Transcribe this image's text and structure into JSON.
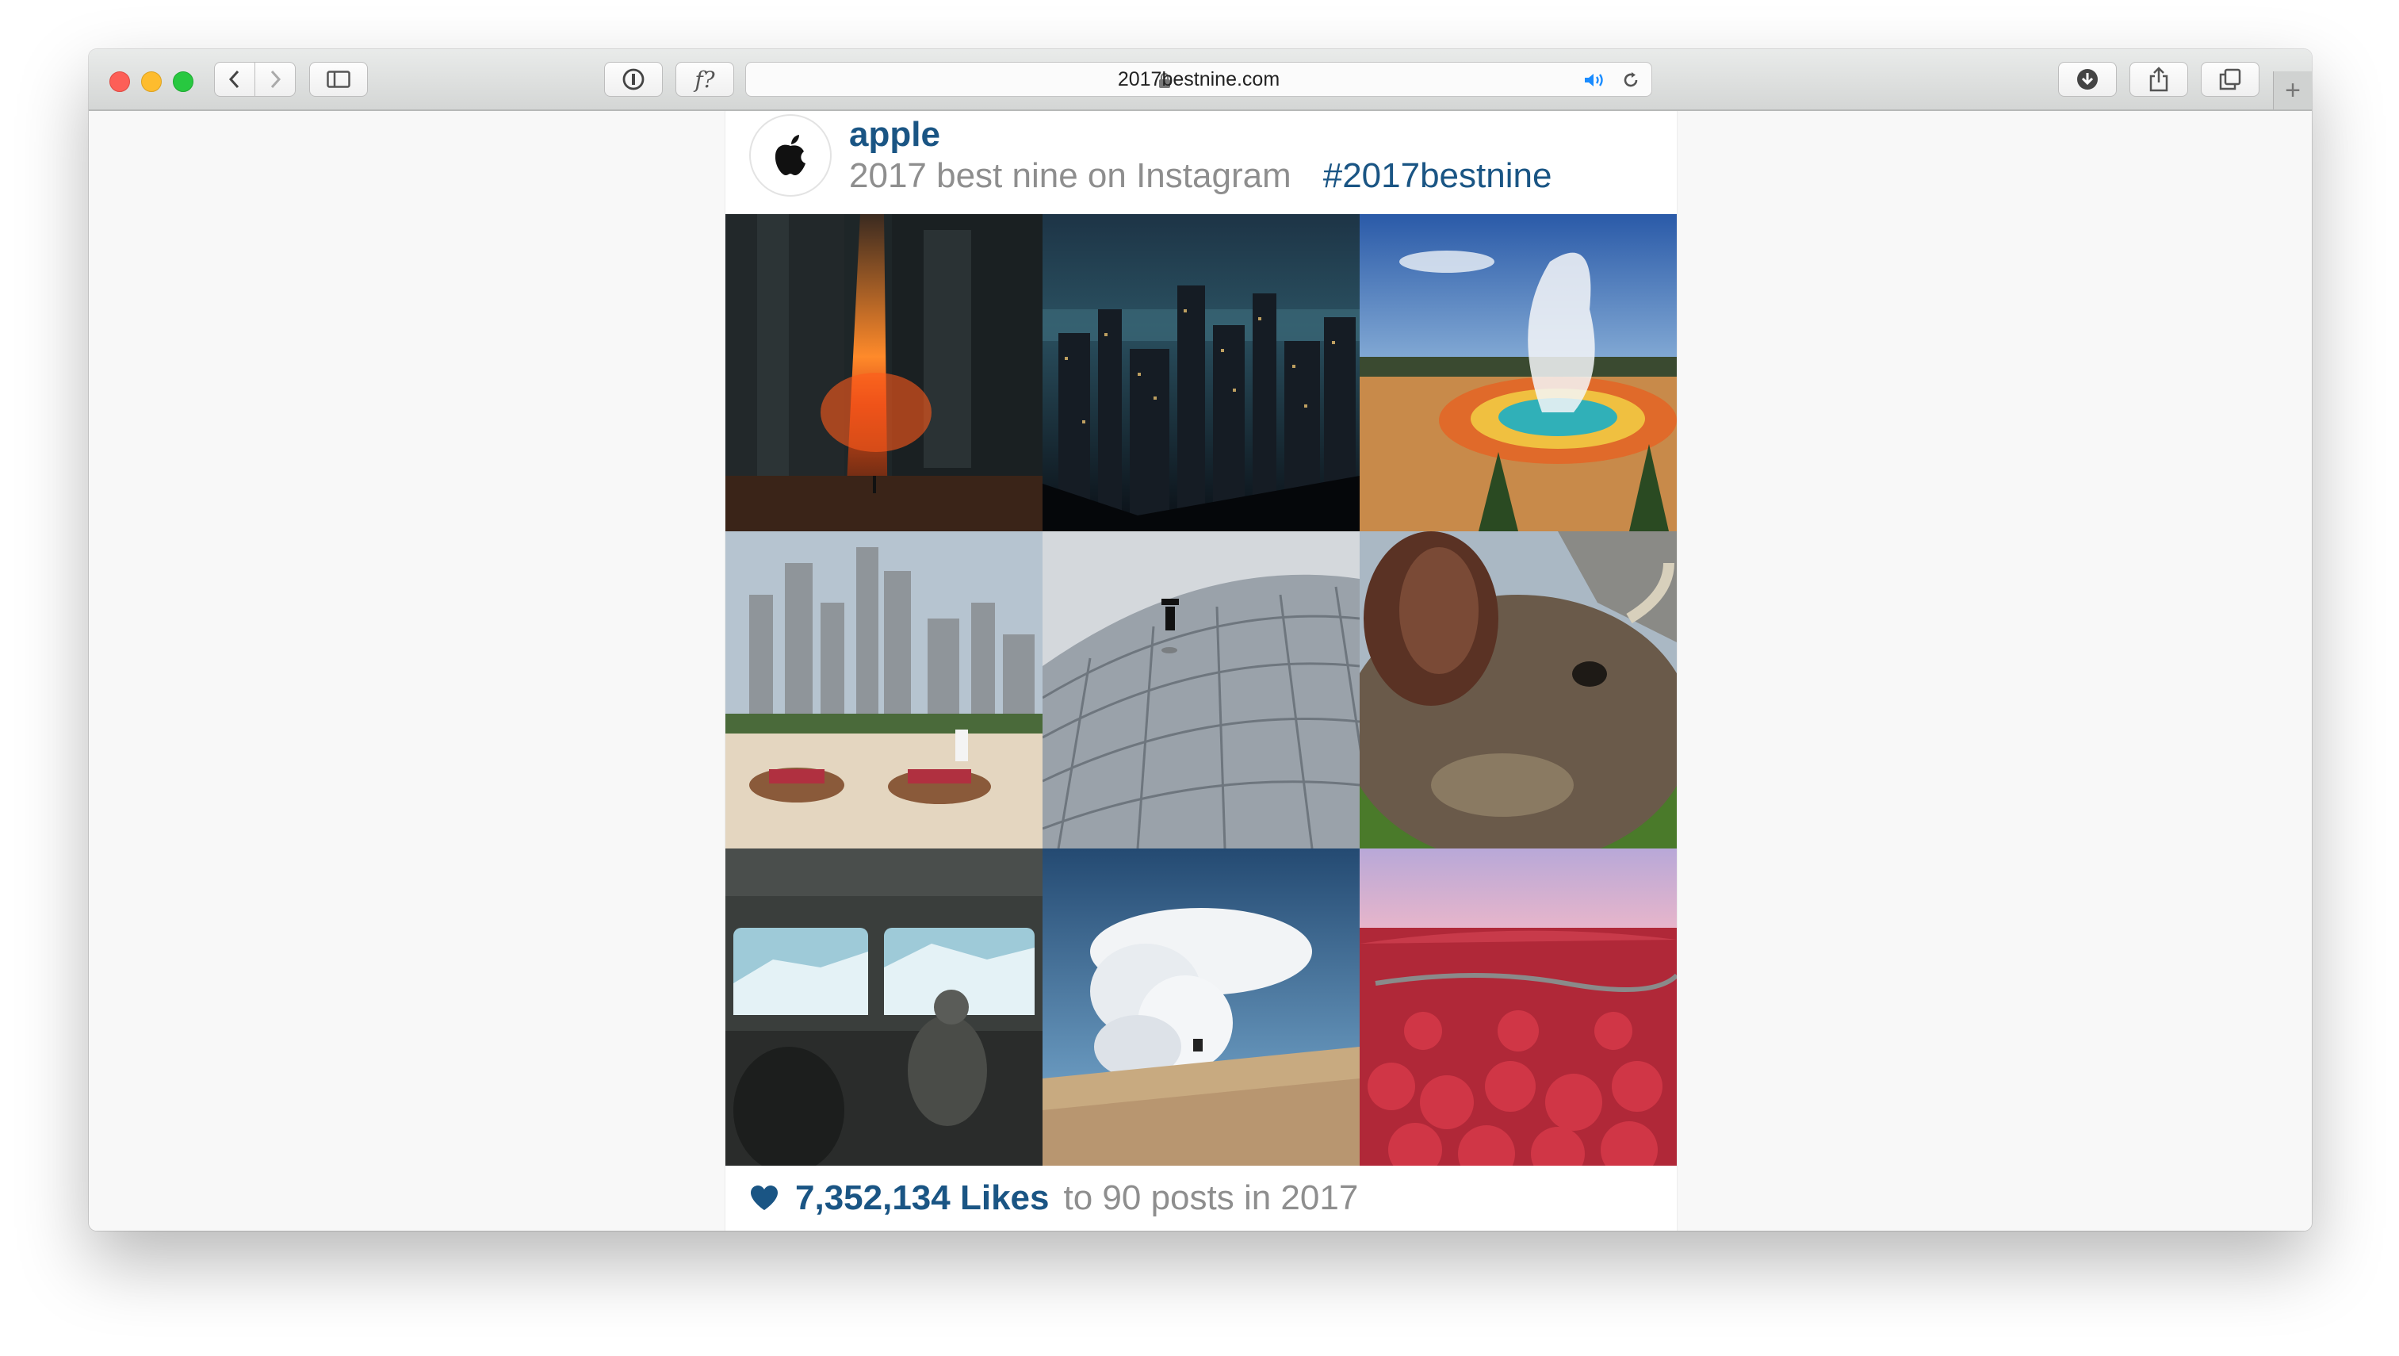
{
  "browser": {
    "url": "2017bestnine.com",
    "new_tab_symbol": "+",
    "reader_symbol": "f?"
  },
  "profile": {
    "username": "apple",
    "subtitle": "2017 best nine on Instagram",
    "hashtag": "#2017bestnine"
  },
  "grid": {
    "photos": [
      "city-sunset-street",
      "night-skyline",
      "geyser-hot-spring",
      "desert-camels-skyline",
      "curved-tiled-roof-jumper",
      "cow-closeup",
      "bus-window-glacier",
      "cumulus-cloud-desert",
      "red-kochia-hills"
    ]
  },
  "footer": {
    "likes": "7,352,134 Likes",
    "rest": "to 90 posts in 2017"
  },
  "colors": {
    "accent": "#1a5584",
    "muted": "#8e8e8e",
    "traffic_close": "#fd5f57",
    "traffic_min": "#febc2e",
    "traffic_max": "#28c840"
  }
}
